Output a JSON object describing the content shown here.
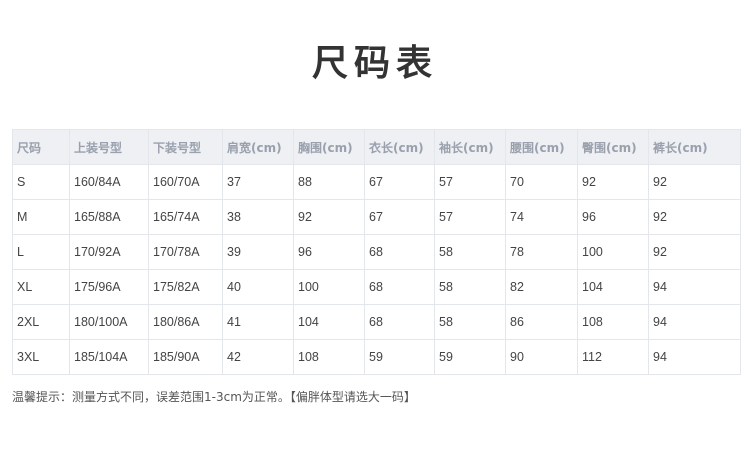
{
  "title": "尺码表",
  "table": {
    "headers": [
      "尺码",
      "上装号型",
      "下装号型",
      "肩宽(cm)",
      "胸围(cm)",
      "衣长(cm)",
      "袖长(cm)",
      "腰围(cm)",
      "臀围(cm)",
      "裤长(cm)"
    ],
    "rows": [
      [
        "S",
        "160/84A",
        "160/70A",
        "37",
        "88",
        "67",
        "57",
        "70",
        "92",
        "92"
      ],
      [
        "M",
        "165/88A",
        "165/74A",
        "38",
        "92",
        "67",
        "57",
        "74",
        "96",
        "92"
      ],
      [
        "L",
        "170/92A",
        "170/78A",
        "39",
        "96",
        "68",
        "58",
        "78",
        "100",
        "92"
      ],
      [
        "XL",
        "175/96A",
        "175/82A",
        "40",
        "100",
        "68",
        "58",
        "82",
        "104",
        "94"
      ],
      [
        "2XL",
        "180/100A",
        "180/86A",
        "41",
        "104",
        "68",
        "58",
        "86",
        "108",
        "94"
      ],
      [
        "3XL",
        "185/104A",
        "185/90A",
        "42",
        "108",
        "59",
        "59",
        "90",
        "112",
        "94"
      ]
    ]
  },
  "footnote": "温馨提示：测量方式不同，误差范围1-3cm为正常。【偏胖体型请选大一码】"
}
